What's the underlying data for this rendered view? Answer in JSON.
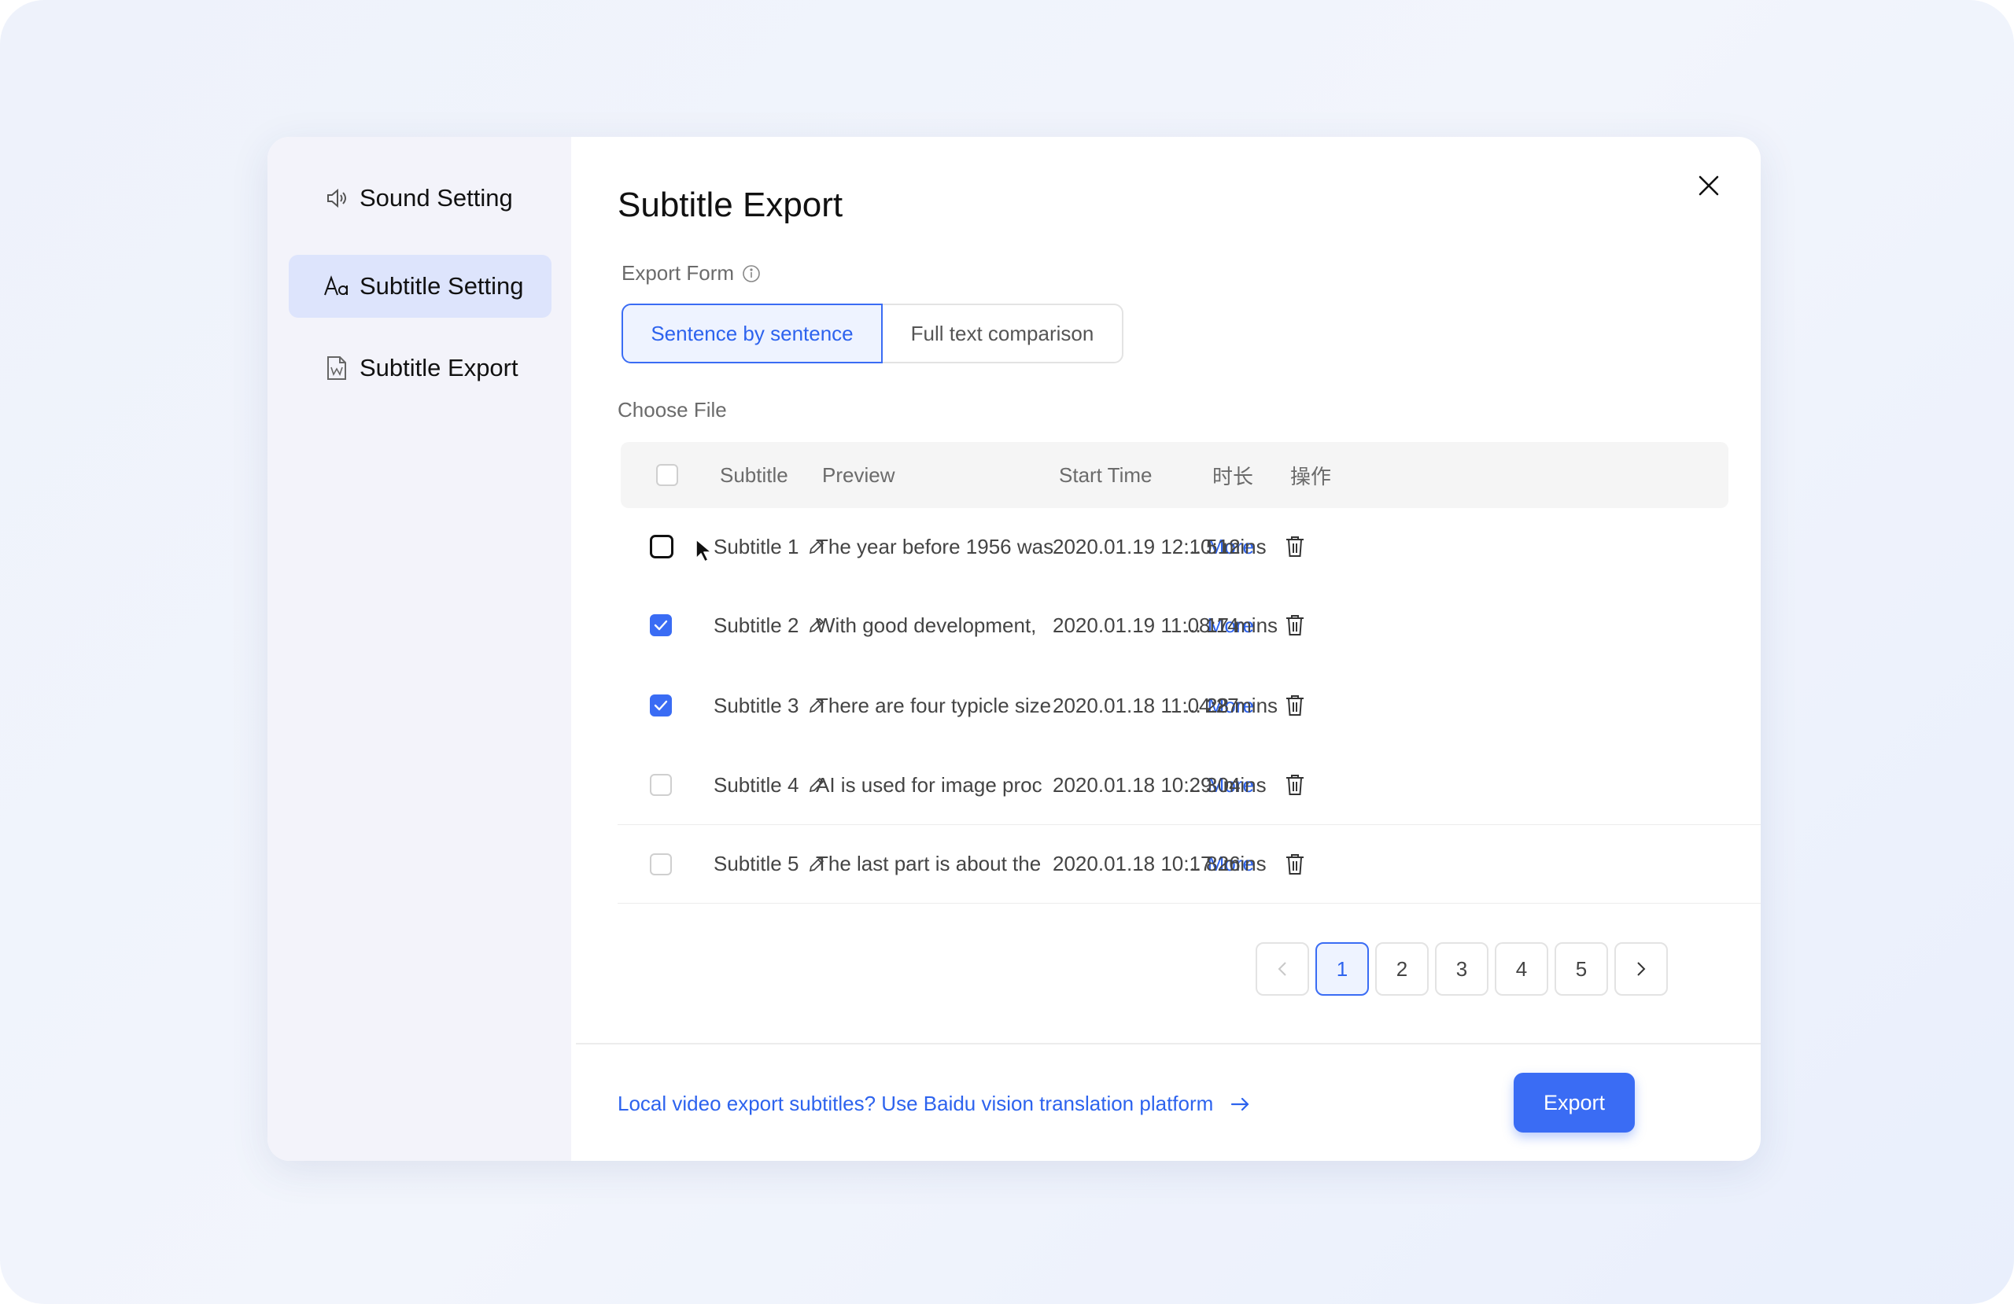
{
  "sidebar": {
    "items": [
      {
        "label": "Sound Setting",
        "icon": "speaker-icon",
        "active": false
      },
      {
        "label": "Subtitle Setting",
        "icon": "font-aa-icon",
        "active": true
      },
      {
        "label": "Subtitle Export",
        "icon": "word-file-icon",
        "active": false
      }
    ]
  },
  "dialog": {
    "title": "Subtitle Export",
    "close_icon": "close-icon"
  },
  "export_form": {
    "label": "Export Form",
    "options": [
      "Sentence by sentence",
      "Full text comparison"
    ],
    "selected": "Sentence by sentence"
  },
  "choose_file": {
    "label": "Choose File"
  },
  "table": {
    "columns": [
      "Subtitle",
      "Preview",
      "Start Time",
      "时长",
      "操作"
    ],
    "rows": [
      {
        "subtitle": "Subtitle 1",
        "preview": "The year before 1956 was",
        "more": "More",
        "start": "2020.01.19 12:10:12",
        "duration": "5 mins",
        "checked": false,
        "hover": true
      },
      {
        "subtitle": "Subtitle 2",
        "preview": "With good development,",
        "more": "More",
        "start": "2020.01.19 11:08:14",
        "duration": "17 mins",
        "checked": true,
        "hover": false
      },
      {
        "subtitle": "Subtitle 3",
        "preview": "There are four typicle size",
        "more": "More",
        "start": "2020.01.18 11:04:27",
        "duration": "28 mins",
        "checked": true,
        "hover": false
      },
      {
        "subtitle": "Subtitle 4",
        "preview": "AI is used for image proc",
        "more": "More",
        "start": "2020.01.18 10:29:04",
        "duration": "3 mins",
        "checked": false,
        "hover": false
      },
      {
        "subtitle": "Subtitle 5",
        "preview": "The last part is about the",
        "more": "More",
        "start": "2020.01.18 10:17:26",
        "duration": "8 mins",
        "checked": false,
        "hover": false
      }
    ],
    "ellipsis": "..."
  },
  "pagination": {
    "pages": [
      "1",
      "2",
      "3",
      "4",
      "5"
    ],
    "current": "1"
  },
  "footer": {
    "link_text": "Local video export subtitles? Use Baidu vision translation platform",
    "export_label": "Export"
  },
  "colors": {
    "accent": "#3a6cf4",
    "sidebar_bg": "#f3f3fa",
    "active_item_bg": "#dde4fc",
    "background": "#eef2fb"
  }
}
